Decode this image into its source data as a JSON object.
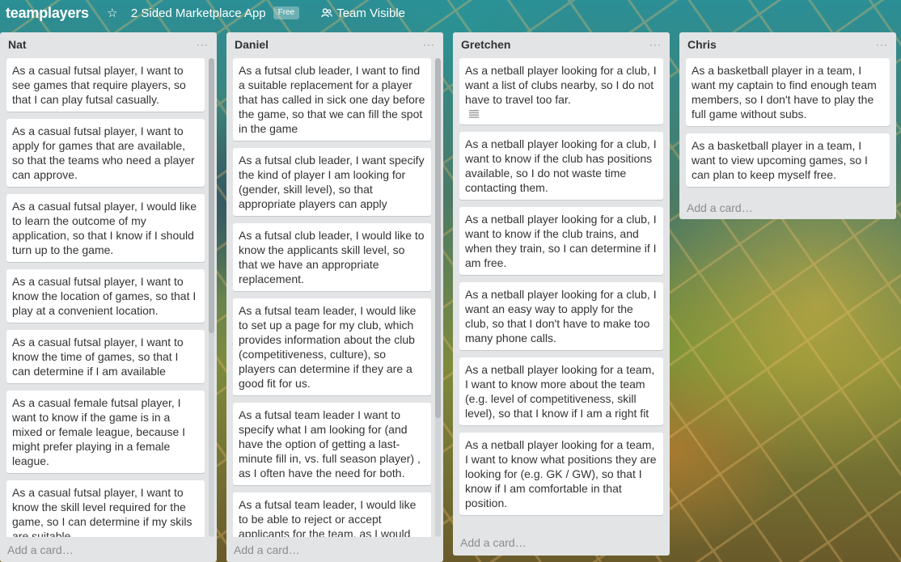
{
  "header": {
    "board_title": "teamplayers",
    "team_name": "2 Sided Marketplace App",
    "plan_badge": "Free",
    "visibility": "Team Visible"
  },
  "lists": [
    {
      "name": "Nat",
      "cards": [
        "As a casual futsal player, I want to see games that require players, so that I can play futsal casually.",
        "As a casual futsal player, I want to apply for games that are available, so that the teams who need a player can approve.",
        "As a casual futsal player, I would like to learn the outcome of my application, so that I know if I should turn up to the game.",
        "As a casual futsal player, I want to know the location of games, so that I play at a convenient location.",
        "As a casual futsal player, I want to know the time of games, so that I can determine if I am available",
        "As a casual female futsal player, I want to know if the game is in a mixed or female league, because I might prefer playing in a female league.",
        "As a casual futsal player, I want to know the skill level required for the game, so I can determine if my skils are suitable"
      ],
      "add_label": "Add a card…"
    },
    {
      "name": "Daniel",
      "cards": [
        "As a futsal club leader, I want to find a suitable replacement for a player that has called in sick one day before the game, so that we can fill the spot in the game",
        "As a futsal club leader, I want specify the kind of player I am looking for (gender, skill level), so that appropriate players can apply",
        "As a futsal club leader, I would like to know the applicants skill level, so that we have an appropriate replacement.",
        "As a futsal team leader, I would like to set up a page for my club, which provides information about the club (competitiveness, culture), so players can determine if they are a good fit for us.",
        "As a futsal team leader I want to specify what I am looking for (and have the option of getting a last-minute fill in, vs. full season player) , as I often have the need for both.",
        "As a futsal team leader, I would like to be able to reject or accept applicants for the team, as I would"
      ],
      "add_label": "Add a card…"
    },
    {
      "name": "Gretchen",
      "cards": [
        "As a netball player looking for a club, I want a list of clubs nearby, so I do not have to travel too far.",
        "As a netball player looking for a club, I want to know if the club has positions available, so I do not waste time contacting them.",
        "As a netball player looking for a club, I want to know if the club trains, and when they train, so I can determine if I am free.",
        "As a netball player looking for a club, I want an easy way to apply for the club, so that I don't have to make too many phone calls.",
        "As a netball player looking for a team, I want to know more about the team (e.g. level of competitiveness, skill level), so that I know if I am a right fit",
        "As a netball player looking for a team, I want to know what positions they are looking for (e.g. GK / GW), so that I know if I am comfortable in that position."
      ],
      "add_label": "Add a card…"
    },
    {
      "name": "Chris",
      "cards": [
        "As a basketball player in a team, I want my captain to find enough team members, so I don't have to play the full game without subs.",
        "As a basketball player in a team, I want to view upcoming games, so I can plan to keep myself free."
      ],
      "add_label": "Add a card…"
    }
  ],
  "menu_glyph": "···",
  "icons": {
    "star": "star-icon",
    "visibility": "team-visible-icon",
    "description": "description-icon"
  }
}
